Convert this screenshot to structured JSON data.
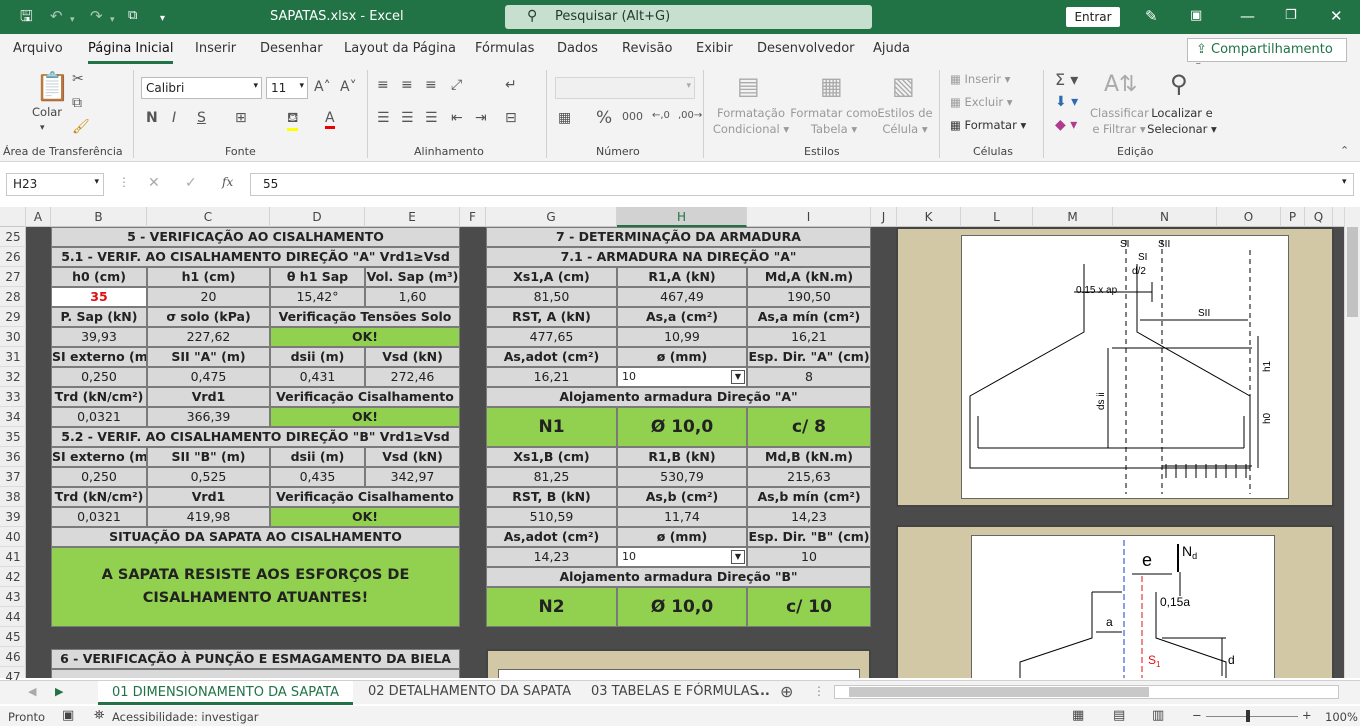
{
  "titlebar": {
    "title": "SAPATAS.xlsx  -  Excel",
    "search_placeholder": "Pesquisar (Alt+G)",
    "signin_label": "Entrar"
  },
  "ribbon_tabs": [
    "Arquivo",
    "Página Inicial",
    "Inserir",
    "Desenhar",
    "Layout da Página",
    "Fórmulas",
    "Dados",
    "Revisão",
    "Exibir",
    "Desenvolvedor",
    "Ajuda"
  ],
  "share_label": "Compartilhamento",
  "ribbon": {
    "paste_label": "Colar",
    "font_name": "Calibri",
    "font_size": "11",
    "cond_format": [
      "Formatação",
      "Condicional"
    ],
    "format_table": [
      "Formatar como",
      "Tabela"
    ],
    "cell_styles": [
      "Estilos de",
      "Célula"
    ],
    "insert": "Inserir",
    "delete": "Excluir",
    "format": "Formatar",
    "sort_filter": [
      "Classificar",
      "e Filtrar"
    ],
    "find_select": [
      "Localizar e",
      "Selecionar"
    ],
    "groups": [
      "Área de Transferência",
      "Fonte",
      "Alinhamento",
      "Número",
      "Estilos",
      "Células",
      "Edição"
    ]
  },
  "formula_bar": {
    "name_box": "H23",
    "fx": "fx",
    "value": "55"
  },
  "columns": [
    "A",
    "B",
    "C",
    "D",
    "E",
    "F",
    "G",
    "H",
    "I",
    "J",
    "K",
    "L",
    "M",
    "N",
    "O",
    "P",
    "Q"
  ],
  "rows": [
    "25",
    "26",
    "27",
    "28",
    "29",
    "30",
    "31",
    "32",
    "33",
    "34",
    "35",
    "36",
    "37",
    "38",
    "39",
    "40",
    "41",
    "42",
    "43",
    "44",
    "45",
    "46",
    "47"
  ],
  "left_table": {
    "title": "5 - VERIFICAÇÃO AO CISALHAMENTO",
    "sub1": "5.1 - VERIF. AO CISALHAMENTO  DIREÇÃO \"A\" Vrd1≥Vsd",
    "r27": [
      "h0 (cm)",
      "h1 (cm)",
      "θ h1 Sap",
      "Vol. Sap (m³)"
    ],
    "r28": [
      "35",
      "20",
      "15,42°",
      "1,60"
    ],
    "r29": [
      "P. Sap (kN)",
      "σ solo (kPa)",
      "Verificação Tensões Solo"
    ],
    "r30": [
      "39,93",
      "227,62",
      "OK!"
    ],
    "r31": [
      "SI externo (m)",
      "SII \"A\" (m)",
      "dsii (m)",
      "Vsd (kN)"
    ],
    "r32": [
      "0,250",
      "0,475",
      "0,431",
      "272,46"
    ],
    "r33": [
      "Ꚍrd (kN/cm²)",
      "Vrd1",
      "Verificação Cisalhamento"
    ],
    "r34": [
      "0,0321",
      "366,39",
      "OK!"
    ],
    "sub2": "5.2 - VERIF. AO CISALHAMENTO  DIREÇÃO \"B\" Vrd1≥Vsd",
    "r36": [
      "SI externo (m)",
      "SII \"B\" (m)",
      "dsii (m)",
      "Vsd (kN)"
    ],
    "r37": [
      "0,250",
      "0,525",
      "0,435",
      "342,97"
    ],
    "r38": [
      "Ꚍrd (kN/cm²)",
      "Vrd1",
      "Verificação Cisalhamento"
    ],
    "r39": [
      "0,0321",
      "419,98",
      "OK!"
    ],
    "r40": "SITUAÇÃO DA SAPATA AO CISALHAMENTO",
    "result": "A SAPATA RESISTE AOS ESFORÇOS DE CISALHAMENTO ATUANTES!",
    "sec6": "6 - VERIFICAÇÃO À PUNÇÃO E ESMAGAMENTO DA BIELA"
  },
  "right_table": {
    "title": "7 - DETERMINAÇÃO DA  ARMADURA",
    "sub1": "7.1 - ARMADURA NA DIREÇÃO \"A\"",
    "r27": [
      "Xs1,A (cm)",
      "R1,A (kN)",
      "Md,A (kN.m)"
    ],
    "r28": [
      "81,50",
      "467,49",
      "190,50"
    ],
    "r29": [
      "RST, A (kN)",
      "As,a (cm²)",
      "As,a mín (cm²)"
    ],
    "r30": [
      "477,65",
      "10,99",
      "16,21"
    ],
    "r31": [
      "As,adot (cm²)",
      "ø (mm)",
      "Esp. Dir. \"A\" (cm)"
    ],
    "r32": [
      "16,21",
      "10",
      "8"
    ],
    "r33": "Alojamento armadura Direção \"A\"",
    "n1": [
      "N1",
      "Ø 10,0",
      "c/ 8"
    ],
    "r36": [
      "Xs1,B (cm)",
      "R1,B (kN)",
      "Md,B (kN.m)"
    ],
    "r37": [
      "81,25",
      "530,79",
      "215,63"
    ],
    "r38": [
      "RST, B (kN)",
      "As,b (cm²)",
      "As,b mín (cm²)"
    ],
    "r39": [
      "510,59",
      "11,74",
      "14,23"
    ],
    "r40": [
      "As,adot (cm²)",
      "ø (mm)",
      "Esp. Dir. \"B\" (cm)"
    ],
    "r41": [
      "14,23",
      "10",
      "10"
    ],
    "r42": "Alojamento armadura Direção \"B\"",
    "n2": [
      "N2",
      "Ø 10,0",
      "c/ 10"
    ]
  },
  "drawing1_labels": {
    "si": "SI",
    "sii": "SII",
    "si2": "SI",
    "d2": "d/2",
    "ap": "0.15 x ap",
    "sii2": "SII",
    "h1": "h1",
    "h0": "h0",
    "dsii": "ds ii"
  },
  "drawing2_labels": {
    "e": "e",
    "nd": "N",
    "nd_sub": "d",
    "a015": "0,15a",
    "a": "a",
    "s1": "S",
    "s1_sub": "1",
    "d": "d"
  },
  "sheet_tabs": [
    "01 DIMENSIONAMENTO DA SAPATA",
    "02 DETALHAMENTO DA SAPATA",
    "03 TABELAS E FÓRMULAS",
    "..."
  ],
  "status": {
    "ready": "Pronto",
    "accessibility": "Acessibilidade: investigar",
    "zoom": "100%"
  },
  "colors": {
    "excel_green": "#217346",
    "ok_green": "#92d050",
    "value_red": "#e01010",
    "panel_tan": "#d3c8a6"
  }
}
